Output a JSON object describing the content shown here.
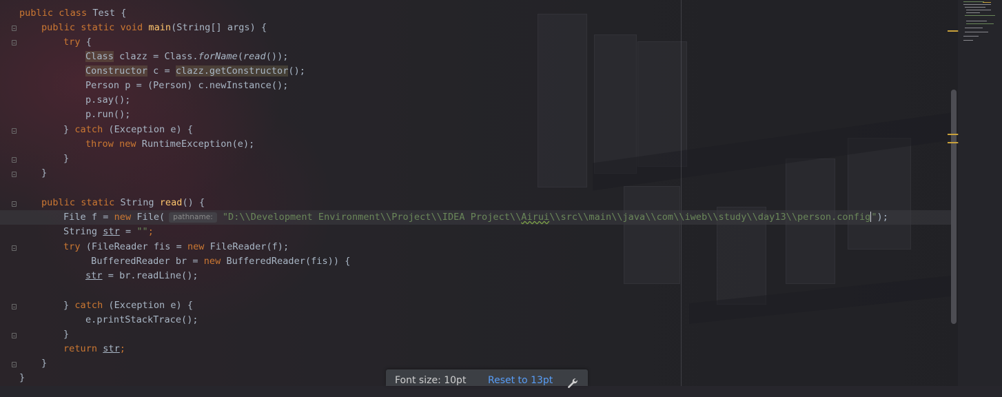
{
  "editor": {
    "inlay_hint": "pathname:",
    "lines": {
      "l1_pre": "public class ",
      "l1_cls": "Test {",
      "l2_kw": "public static void ",
      "l2_fn": "main",
      "l2_rest": "(String[] args) {",
      "l3_kw": "try",
      "l3_rest": " {",
      "l4_a": "Class",
      "l4_b": " clazz = Class.",
      "l4_c": "forName",
      "l4_d": "(",
      "l4_e": "read",
      "l4_f": "());",
      "l5_a": "Constructor",
      "l5_b": " c = ",
      "l5_c": "clazz.getConstructor",
      "l5_d": "();",
      "l6": "Person p = (Person) c.newInstance();",
      "l7": "p.say();",
      "l8": "p.run();",
      "l9_a": "} ",
      "l9_b": "catch",
      "l9_c": " (Exception e) {",
      "l10_a": "throw new",
      "l10_b": " RuntimeException(e);",
      "l11": "}",
      "l12": "}",
      "l14_kw": "public static ",
      "l14_a": "String ",
      "l14_fn": "read",
      "l14_b": "() {",
      "l15_a": "File f = ",
      "l15_kw": "new",
      "l15_b": " File(",
      "l15_s1": "\"D:\\\\Development Environment\\\\Project\\\\IDEA Project\\\\",
      "l15_sq": "Airui",
      "l15_s2": "\\\\src\\\\main\\\\java\\\\com\\\\iweb\\\\study\\\\day13\\\\person.config",
      "l15_s3": "\"",
      "l15_end": ");",
      "l16_a": "String ",
      "l16_b": "str",
      "l16_c": " = ",
      "l16_s": "\"\"",
      "l16_d": ";",
      "l17_kw": "try",
      "l17_a": " (FileReader fis = ",
      "l17_kw2": "new",
      "l17_b": " FileReader(f);",
      "l18_a": " BufferedReader br = ",
      "l18_kw": "new",
      "l18_b": " BufferedReader(fis)) {",
      "l19_a": "str",
      "l19_b": " = br.readLine();",
      "l21_a": "} ",
      "l21_b": "catch",
      "l21_c": " (Exception e) {",
      "l22": "e.printStackTrace();",
      "l23": "}",
      "l24_kw": "return ",
      "l24_a": "str",
      "l24_b": ";",
      "l25": "}",
      "l26": "}"
    }
  },
  "font_popup": {
    "label": "Font size: 10pt",
    "reset_link": "Reset to 13pt",
    "icon": "wrench-icon"
  },
  "colors": {
    "keyword": "#cc7832",
    "method": "#ffc66d",
    "string": "#6a8759",
    "text": "#a9b7c6",
    "link": "#589df6"
  }
}
